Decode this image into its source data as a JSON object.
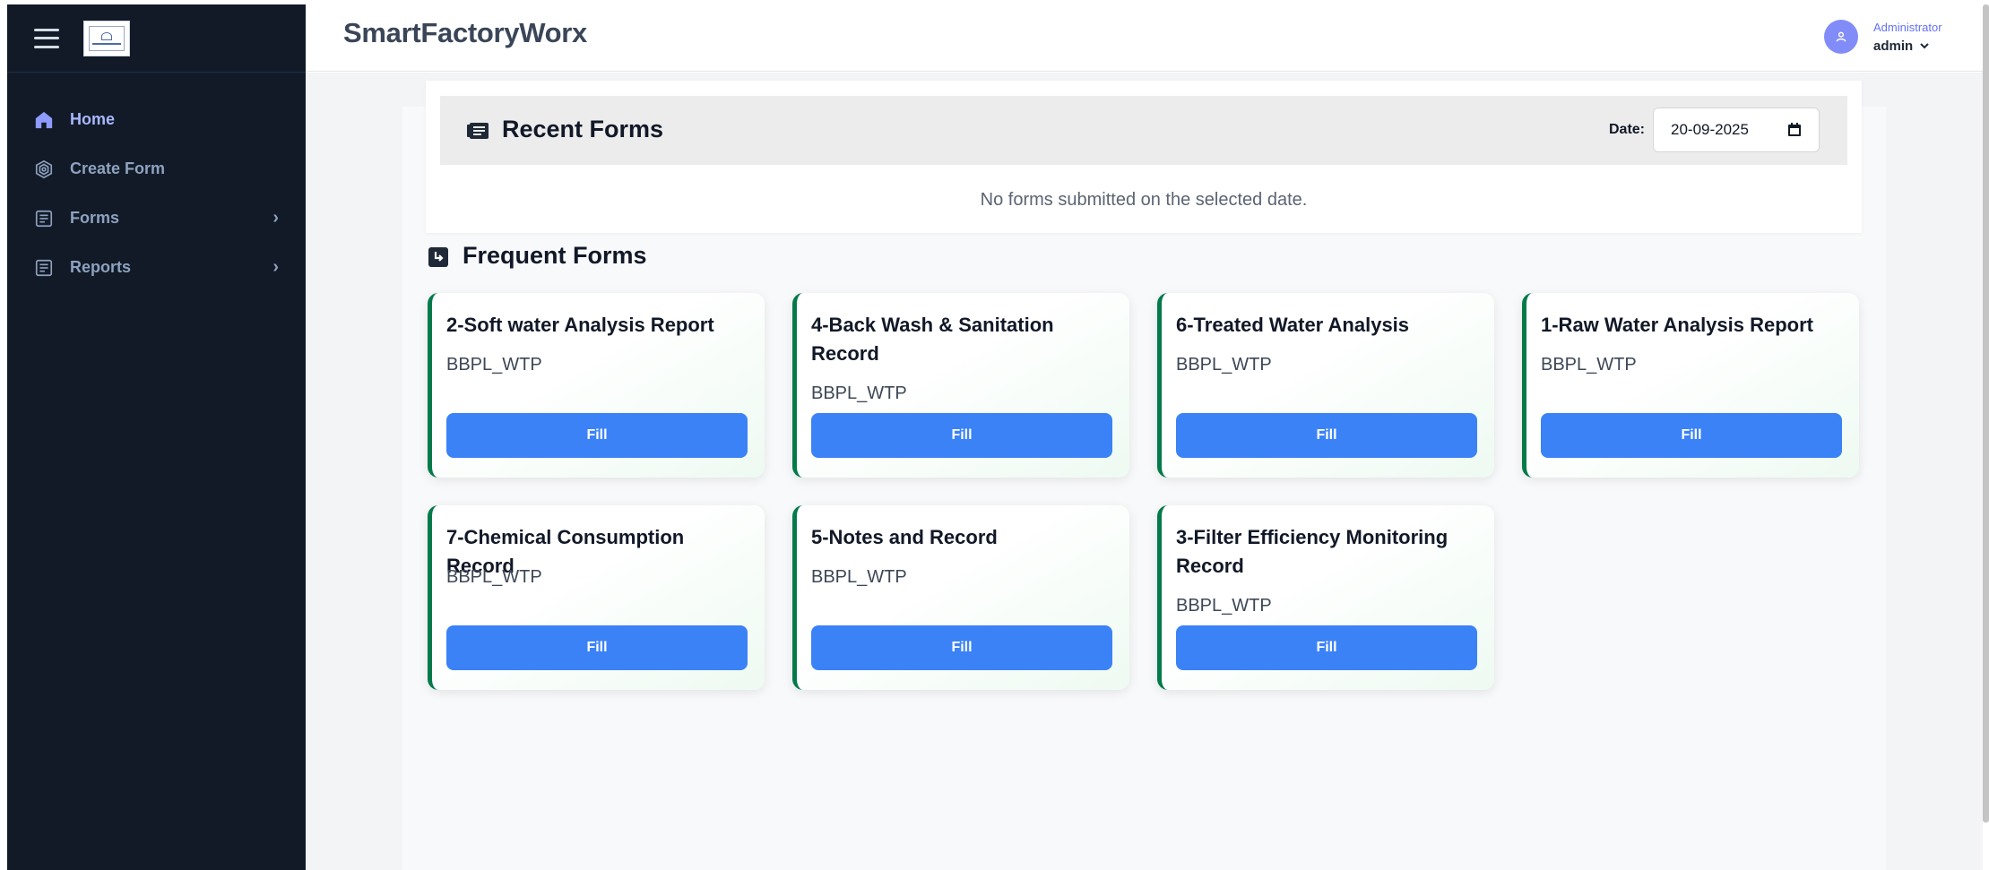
{
  "app": {
    "brand": "SmartFactoryWorx"
  },
  "sidebar": {
    "items": [
      {
        "label": "Home",
        "icon": "home-icon",
        "active": true
      },
      {
        "label": "Create Form",
        "icon": "layers-icon"
      },
      {
        "label": "Forms",
        "icon": "form-list-icon",
        "has_submenu": true
      },
      {
        "label": "Reports",
        "icon": "report-list-icon",
        "has_submenu": true
      }
    ]
  },
  "header": {
    "role": "Administrator",
    "username": "admin"
  },
  "recent": {
    "title": "Recent Forms",
    "date_label": "Date:",
    "date_value": "20-09-2025",
    "empty_message": "No forms submitted on the selected date."
  },
  "frequent": {
    "title": "Frequent Forms",
    "button_label": "Fill",
    "cards": [
      {
        "title": "2-Soft water Analysis Report",
        "subtitle": "BBPL_WTP"
      },
      {
        "title": "4-Back Wash & Sanitation Record",
        "subtitle": "BBPL_WTP"
      },
      {
        "title": "6-Treated Water Analysis",
        "subtitle": "BBPL_WTP"
      },
      {
        "title": "1-Raw Water Analysis Report",
        "subtitle": "BBPL_WTP"
      },
      {
        "title": "7-Chemical Consumption Record",
        "subtitle": "BBPL_WTP"
      },
      {
        "title": "5-Notes and Record",
        "subtitle": "BBPL_WTP"
      },
      {
        "title": "3-Filter Efficiency Monitoring Record",
        "subtitle": "BBPL_WTP"
      }
    ]
  },
  "colors": {
    "sidebar_bg": "#111a26",
    "accent_blue": "#3b82f6",
    "card_accent_green": "#047a4a",
    "avatar": "#818cf8"
  }
}
